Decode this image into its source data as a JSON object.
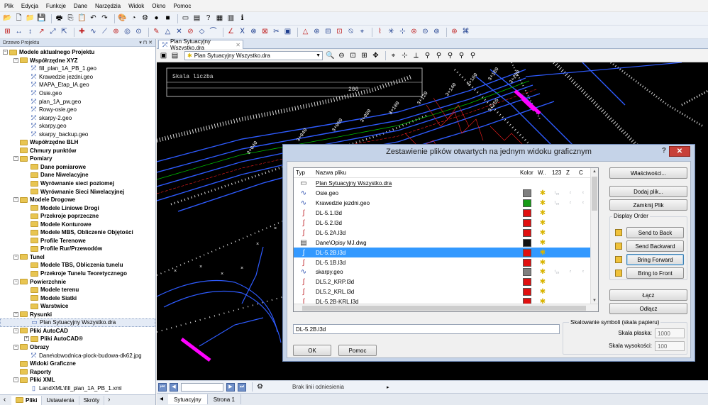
{
  "menu": [
    "Plik",
    "Edycja",
    "Funkcje",
    "Dane",
    "Narzędzia",
    "Widok",
    "Okno",
    "Pomoc"
  ],
  "panel": {
    "title": "Drzewo Projektu",
    "controls": "▾ ⊓ ✕"
  },
  "tree": [
    {
      "label": "Modele aktualnego Projektu",
      "level": 0,
      "exp": "−",
      "kind": "folder",
      "bold": true
    },
    {
      "label": "Współrzędne XYZ",
      "level": 1,
      "exp": "−",
      "kind": "folder",
      "bold": true
    },
    {
      "label": "fill_plan_1A_PB_1.geo",
      "level": 2,
      "kind": "file"
    },
    {
      "label": "Krawedzie jezdni.geo",
      "level": 2,
      "kind": "file"
    },
    {
      "label": "MAPA_Etap_IA.geo",
      "level": 2,
      "kind": "file"
    },
    {
      "label": "Osie.geo",
      "level": 2,
      "kind": "file"
    },
    {
      "label": "plan_1A_pw.geo",
      "level": 2,
      "kind": "file"
    },
    {
      "label": "Rowy-osie.geo",
      "level": 2,
      "kind": "file"
    },
    {
      "label": "skarpy-2.geo",
      "level": 2,
      "kind": "file"
    },
    {
      "label": "skarpy.geo",
      "level": 2,
      "kind": "file"
    },
    {
      "label": "skarpy_backup.geo",
      "level": 2,
      "kind": "file"
    },
    {
      "label": "Współrzędne BLH",
      "level": 1,
      "kind": "folder",
      "bold": true
    },
    {
      "label": "Chmury punktów",
      "level": 1,
      "kind": "folder",
      "bold": true
    },
    {
      "label": "Pomiary",
      "level": 1,
      "exp": "−",
      "kind": "folder",
      "bold": true
    },
    {
      "label": "Dane pomiarowe",
      "level": 2,
      "kind": "folder",
      "bold": true
    },
    {
      "label": "Dane Niwelacyjne",
      "level": 2,
      "kind": "folder",
      "bold": true
    },
    {
      "label": "Wyrównanie sieci poziomej",
      "level": 2,
      "kind": "folder",
      "bold": true
    },
    {
      "label": "Wyrównanie Sieci Niwelacyjnej",
      "level": 2,
      "kind": "folder",
      "bold": true
    },
    {
      "label": "Modele Drogowe",
      "level": 1,
      "exp": "−",
      "kind": "folder",
      "bold": true
    },
    {
      "label": "Modele Liniowe Drogi",
      "level": 2,
      "kind": "folder",
      "bold": true
    },
    {
      "label": "Przekroje poprzeczne",
      "level": 2,
      "kind": "folder",
      "bold": true
    },
    {
      "label": "Modele Konturowe",
      "level": 2,
      "kind": "folder",
      "bold": true
    },
    {
      "label": "Modele MBS, Obliczenie Objętości",
      "level": 2,
      "kind": "folder",
      "bold": true
    },
    {
      "label": "Profile Terenowe",
      "level": 2,
      "kind": "folder",
      "bold": true
    },
    {
      "label": "Profile Rur/Przewodów",
      "level": 2,
      "kind": "folder",
      "bold": true
    },
    {
      "label": "Tunel",
      "level": 1,
      "exp": "−",
      "kind": "folder",
      "bold": true
    },
    {
      "label": "Modele TBS, Obliczenia tunelu",
      "level": 2,
      "kind": "folder",
      "bold": true
    },
    {
      "label": "Przekroje Tunelu Teoretycznego",
      "level": 2,
      "kind": "folder",
      "bold": true
    },
    {
      "label": "Powierzchnie",
      "level": 1,
      "exp": "−",
      "kind": "folder",
      "bold": true
    },
    {
      "label": "Modele terenu",
      "level": 2,
      "kind": "folder",
      "bold": true
    },
    {
      "label": "Modele Siatki",
      "level": 2,
      "kind": "folder",
      "bold": true
    },
    {
      "label": "Warstwice",
      "level": 2,
      "kind": "folder",
      "bold": true
    },
    {
      "label": "Rysunki",
      "level": 1,
      "exp": "−",
      "kind": "folder",
      "bold": true
    },
    {
      "label": "Plan Sytuacyjny Wszystko.dra",
      "level": 2,
      "kind": "draw",
      "selected": true
    },
    {
      "label": "Pliki AutoCAD",
      "level": 1,
      "exp": "−",
      "kind": "folder",
      "bold": true
    },
    {
      "label": "Pliki AutoCAD®",
      "level": 2,
      "exp": "+",
      "kind": "folder",
      "bold": true
    },
    {
      "label": "Obrazy",
      "level": 1,
      "exp": "−",
      "kind": "folder",
      "bold": true
    },
    {
      "label": "Dane\\obwodnica-plock-budowa-dk62.jpg",
      "level": 2,
      "kind": "file"
    },
    {
      "label": "Widoki Graficzne",
      "level": 1,
      "kind": "folder",
      "bold": true
    },
    {
      "label": "Raporty",
      "level": 1,
      "kind": "folder",
      "bold": true
    },
    {
      "label": "Pliki XML",
      "level": 1,
      "exp": "−",
      "kind": "folder",
      "bold": true
    },
    {
      "label": "LandXML\\fill_plan_1A_PB_1.xml",
      "level": 2,
      "kind": "page"
    }
  ],
  "panel_tabs": [
    "Pliki",
    "Ustawienia",
    "Skróty"
  ],
  "doc_tab": "Plan Sytuacyjny Wszystko.dra",
  "drawing_select": "Plan Sytuacyjny Wszystko.dra",
  "canvas": {
    "label_skala": "Skala liczba",
    "scale_value": "200",
    "station_labels": [
      "3+040",
      "3+040",
      "3+060",
      "3+080",
      "3+100",
      "3+120",
      "3+140",
      "3+160",
      "3+180",
      "3+200",
      "3+220",
      "3+240",
      "3+255"
    ],
    "road_colors": {
      "main": "#2e5bff",
      "accent": "#ff00ff",
      "center": "#ffffff",
      "annot": "#ff2020",
      "green": "#00ff00"
    }
  },
  "status": {
    "nav_text": "Brak linii odniesienia"
  },
  "sheets": [
    "Sytuacyjny",
    "Strona 1"
  ],
  "dialog": {
    "title": "Zestawienie plików otwartych na jednym widoku graficznym",
    "help": "?",
    "close": "✕",
    "columns": {
      "typ": "Typ",
      "name": "Nazwa pliku",
      "kolor": "Kolor",
      "w": "W..",
      "c123": "123",
      "z": "Z",
      "c": "C"
    },
    "rows": [
      {
        "name": "Plan Sytuacyjny Wszystko.dra",
        "icon": "▭",
        "color": null,
        "w": "",
        "underline": true
      },
      {
        "name": "Osie.geo",
        "icon": "∿",
        "color": "#7f7f7f",
        "w": "✱",
        "c123": "¹₂₃",
        "z": "ᶻ",
        "c": "ᶜ"
      },
      {
        "name": "Krawedzie jezdni.geo",
        "icon": "∿",
        "color": "#169c16",
        "w": "✱",
        "c123": "¹₂₃",
        "z": "ᶻ",
        "c": "ᶜ"
      },
      {
        "name": "DL-5.1.l3d",
        "icon": "∫",
        "color": "#e01010",
        "w": "✱"
      },
      {
        "name": "DL-5.2.l3d",
        "icon": "∫",
        "color": "#e01010",
        "w": "✱"
      },
      {
        "name": "DL-5.2A.l3d",
        "icon": "∫",
        "color": "#e01010",
        "w": "✱"
      },
      {
        "name": "Dane\\Opisy MJ.dwg",
        "icon": "▤",
        "color": "#111111",
        "w": "✱"
      },
      {
        "name": "DL-5.2B.l3d",
        "icon": "∫",
        "color": "#e01010",
        "w": "✱",
        "selected": true
      },
      {
        "name": "DL-5.1B.l3d",
        "icon": "∫",
        "color": "#e01010",
        "w": "✱"
      },
      {
        "name": "skarpy.geo",
        "icon": "∿",
        "color": "#7f7f7f",
        "w": "✱",
        "c123": "¹₂₃",
        "z": "ᶻ",
        "c": "ᶜ"
      },
      {
        "name": "DL5.2_KRP.l3d",
        "icon": "∫",
        "color": "#e01010",
        "w": "✱"
      },
      {
        "name": "DL5.2_KRL.l3d",
        "icon": "∫",
        "color": "#e01010",
        "w": "✱"
      },
      {
        "name": "DL-5.2B-KRL.l3d",
        "icon": "∫",
        "color": "#e01010",
        "w": "✱"
      }
    ],
    "buttons": {
      "properties": "Właściwości...",
      "add_file": "Dodaj plik...",
      "close_file": "Zamknij Plik",
      "display_order": "Display Order",
      "send_back": "Send to Back",
      "send_backward": "Send Backward",
      "bring_forward": "Bring Forward",
      "bring_front": "Bring to Front",
      "connect": "Łącz",
      "disconnect": "Odłącz",
      "ok": "OK",
      "help": "Pomoc"
    },
    "current_file": "DL-5.2B.l3d",
    "scaling": {
      "title": "Skalowanie symboli (skala papieru)",
      "flat_label": "Skala płaska:",
      "flat_value": "1000",
      "height_label": "Skala wysokości:",
      "height_value": "100"
    }
  }
}
